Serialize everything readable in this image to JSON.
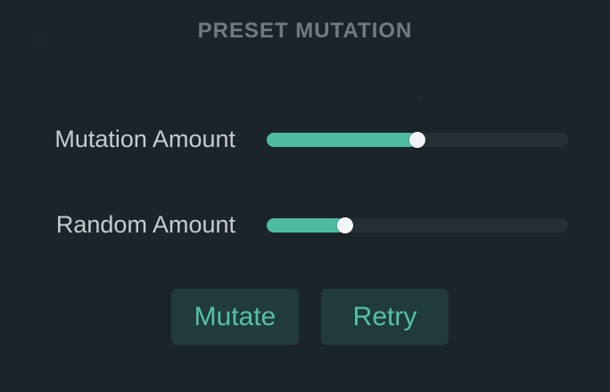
{
  "title": "PRESET MUTATION",
  "sliders": [
    {
      "label": "Mutation Amount",
      "value_fraction": 0.5
    },
    {
      "label": "Random Amount",
      "value_fraction": 0.26
    }
  ],
  "buttons": {
    "mutate": "Mutate",
    "retry": "Retry"
  },
  "colors": {
    "background": "#1b242b",
    "accent": "#4cbba0",
    "track": "#252f36",
    "button_bg": "#213a3a",
    "label_text": "#c6cbcf",
    "title_text": "#6f7a82",
    "thumb": "#f2f3f4"
  }
}
